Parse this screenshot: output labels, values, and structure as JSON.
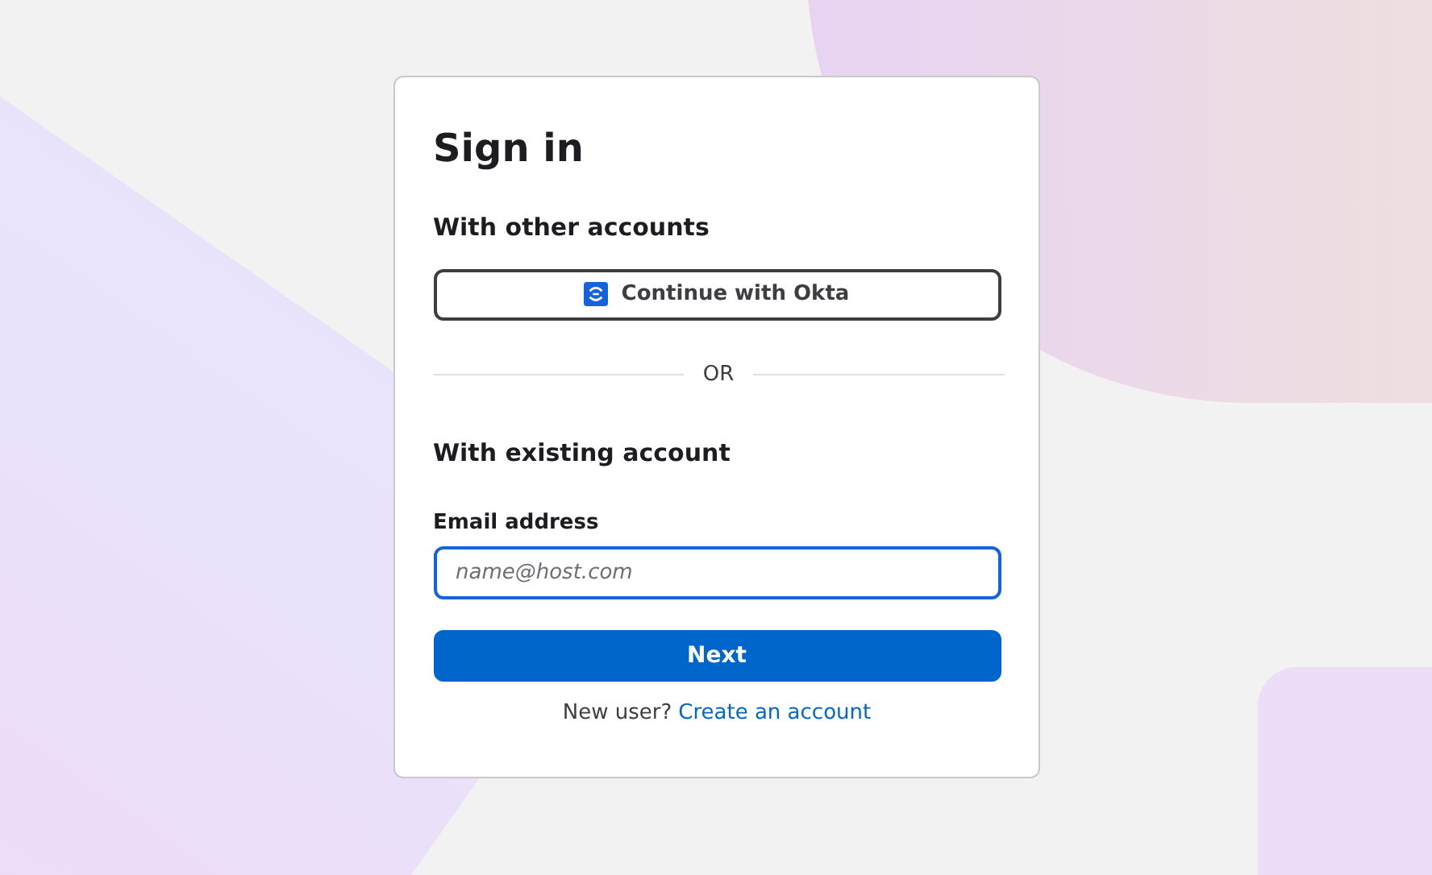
{
  "title": "Sign in",
  "other_accounts": {
    "heading": "With other accounts",
    "button": "Continue with Okta"
  },
  "divider": "OR",
  "existing_account": {
    "heading": "With existing account",
    "email": {
      "label": "Email address",
      "placeholder": "name@host.com",
      "focused": true
    },
    "submit": "Next"
  },
  "footer": {
    "text": "New user?",
    "link": "Create an account"
  }
}
